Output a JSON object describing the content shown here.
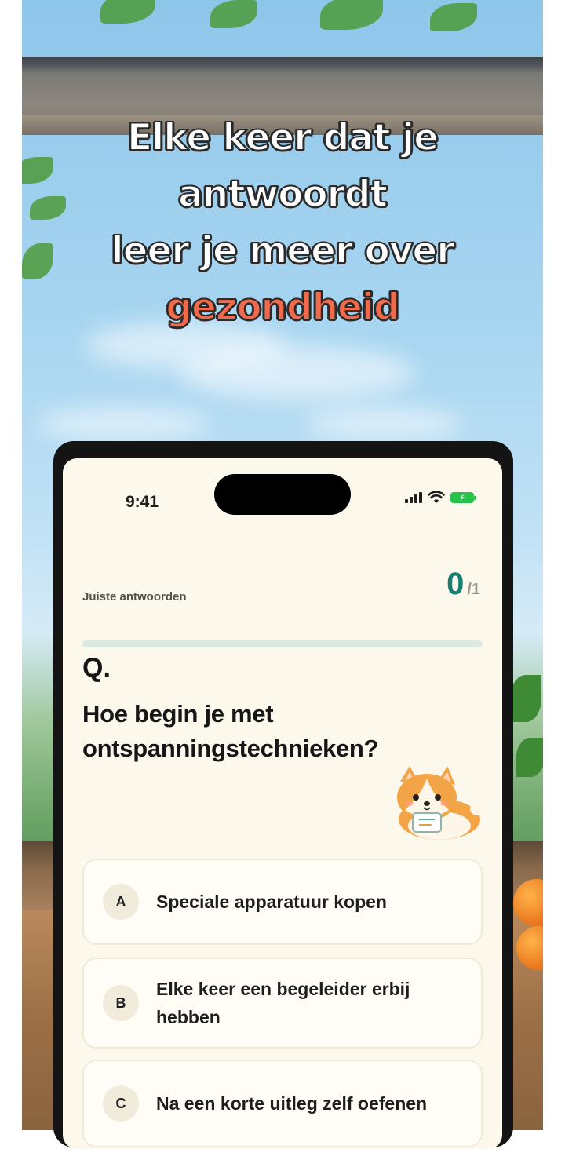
{
  "headline": {
    "line1": "Elke keer dat je",
    "line2": "antwoordt",
    "line3": "leer je meer over",
    "accent": "gezondheid"
  },
  "status_bar": {
    "time": "9:41",
    "icons": [
      "signal-icon",
      "wifi-icon",
      "battery-charging-icon"
    ]
  },
  "score": {
    "label": "Juiste antwoorden",
    "correct": "0",
    "total": "/1",
    "progress": 0
  },
  "quiz": {
    "q_mark": "Q.",
    "question": "Hoe begin je met ontspanningstechnieken?",
    "mascot": "corgi-mascot-icon",
    "options": [
      {
        "letter": "A",
        "text": "Speciale apparatuur kopen"
      },
      {
        "letter": "B",
        "text": "Elke keer een begeleider erbij hebben"
      },
      {
        "letter": "C",
        "text": "Na een korte uitleg zelf oefenen"
      }
    ]
  },
  "colors": {
    "accent_teal": "#167f72",
    "headline_accent": "#f06a4b",
    "screen_bg": "#fdf8ec"
  }
}
